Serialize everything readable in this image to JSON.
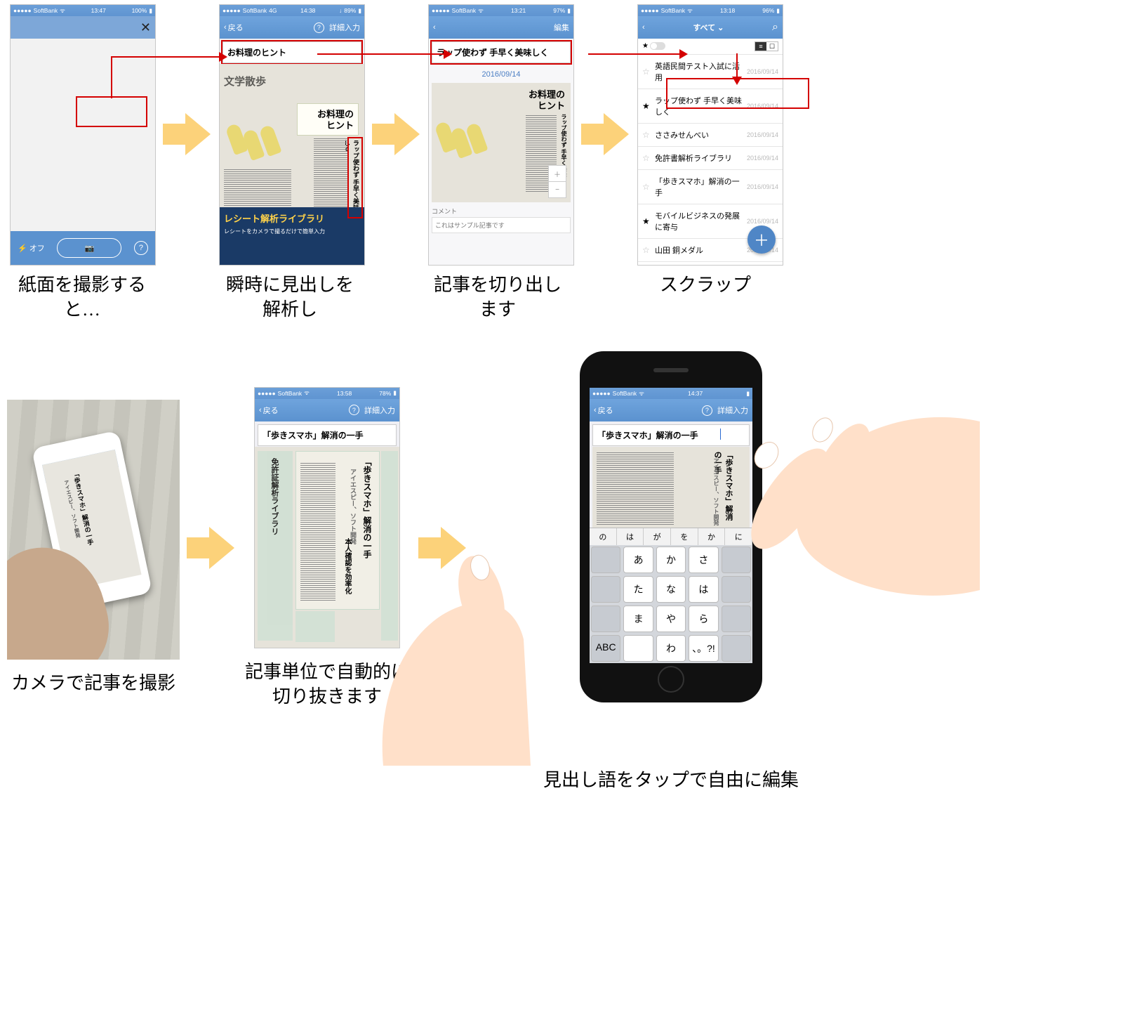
{
  "captions_row1": [
    "紙面を撮影すると…",
    "瞬時に見出しを解析し",
    "記事を切り出します",
    "スクラップ"
  ],
  "captions_row2": [
    "カメラで記事を撮影",
    "記事単位で自動的に\n切り抜きます",
    "見出し語をタップで自由に編集"
  ],
  "status": {
    "carrier_dots": "●●●●●",
    "carrier": "SoftBank",
    "wifi": "ᯤ",
    "net4g": "4G",
    "t1": "13:47",
    "b1": "100%",
    "t2": "14:38",
    "b2": "89%",
    "t3": "13:21",
    "b3": "97%",
    "t4": "13:18",
    "b4": "96%",
    "t5": "13:58",
    "b5": "78%",
    "t6": "14:37",
    "b6": ""
  },
  "nav": {
    "back": "戻る",
    "detail": "詳細入力",
    "edit": "編集",
    "all": "すべて",
    "help": "?",
    "close": "✕",
    "chev_left": "‹",
    "chev_down": "⌄",
    "search": "⌕"
  },
  "camera": {
    "flash_off": "オフ",
    "flash_icon": "⚡",
    "shutter_icon": "📷",
    "help_icon": "?"
  },
  "article": {
    "hint_line1": "お料理の",
    "hint_line2": "ヒント",
    "hint_full": "お料理のヒント",
    "headline_detected": "ラップ使わず 手早く美味しく",
    "headline_vertical": "ラップ使わず 手早く美味しく",
    "date": "2016/09/14",
    "comment_label": "コメント",
    "comment_value": "これはサンプル記事です",
    "bottom_banner": "レシート解析ライブラリ",
    "bottom_banner_sub1": "レシートをカメラで撮るだけで簡単入力",
    "side_title": "文学散歩",
    "aruki_headline": "「歩きスマホ」解消の一手",
    "aruki_v": "「歩きスマホ」解消の一手",
    "aruki_sub": "アイエスピー、ソフト開発",
    "menkyo": "免許証解析ライブラリ",
    "honnin": "本人確認を効率化"
  },
  "list": {
    "items": [
      {
        "star": false,
        "title": "英語民間テスト入試に活用",
        "date": "2016/09/14"
      },
      {
        "star": true,
        "title": "ラップ使わず 手早く美味しく",
        "date": "2016/09/14"
      },
      {
        "star": false,
        "title": "ささみせんべい",
        "date": "2016/09/14"
      },
      {
        "star": false,
        "title": "免許書解析ライブラリ",
        "date": "2016/09/14"
      },
      {
        "star": false,
        "title": "「歩きスマホ」解消の一手",
        "date": "2016/09/14"
      },
      {
        "star": true,
        "title": "モバイルビジネスの発展に寄与",
        "date": "2016/09/14"
      },
      {
        "star": false,
        "title": "山田 銅メダル",
        "date": "2016/09/14"
      }
    ],
    "fab": "＋"
  },
  "keyboard": {
    "suggestions": [
      "の",
      "は",
      "が",
      "を",
      "か",
      "に"
    ],
    "rows": [
      [
        "",
        "あ",
        "か",
        "さ",
        ""
      ],
      [
        "",
        "た",
        "な",
        "は",
        ""
      ],
      [
        "",
        "ま",
        "や",
        "ら",
        ""
      ],
      [
        "ABC",
        "",
        "わ",
        "、。?!",
        ""
      ]
    ]
  },
  "zoom": {
    "plus": "＋",
    "minus": "−"
  }
}
